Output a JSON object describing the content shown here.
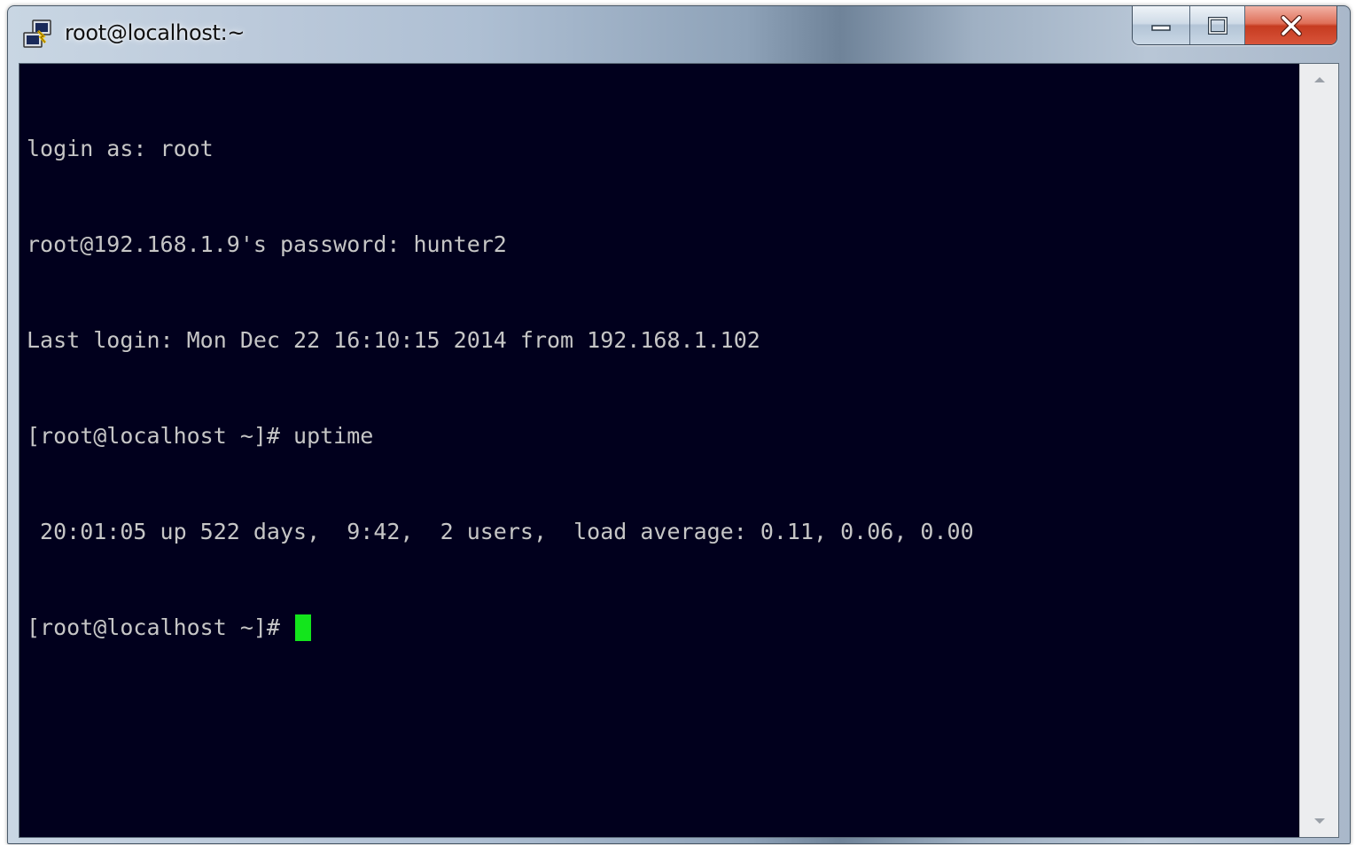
{
  "window": {
    "title": "root@localhost:~"
  },
  "icons": {
    "app": "putty-icon",
    "minimize": "minimize-icon",
    "maximize": "maximize-icon",
    "close": "close-icon",
    "scroll_up": "scroll-up-arrow-icon",
    "scroll_down": "scroll-down-arrow-icon"
  },
  "terminal": {
    "lines": [
      "login as: root",
      "root@192.168.1.9's password: hunter2",
      "Last login: Mon Dec 22 16:10:15 2014 from 192.168.1.102",
      "[root@localhost ~]# uptime",
      " 20:01:05 up 522 days,  9:42,  2 users,  load average: 0.11, 0.06, 0.00"
    ],
    "prompt": "[root@localhost ~]# ",
    "background_color": "#01001d",
    "text_color": "#c6c6c6",
    "cursor_color": "#13e51c"
  }
}
